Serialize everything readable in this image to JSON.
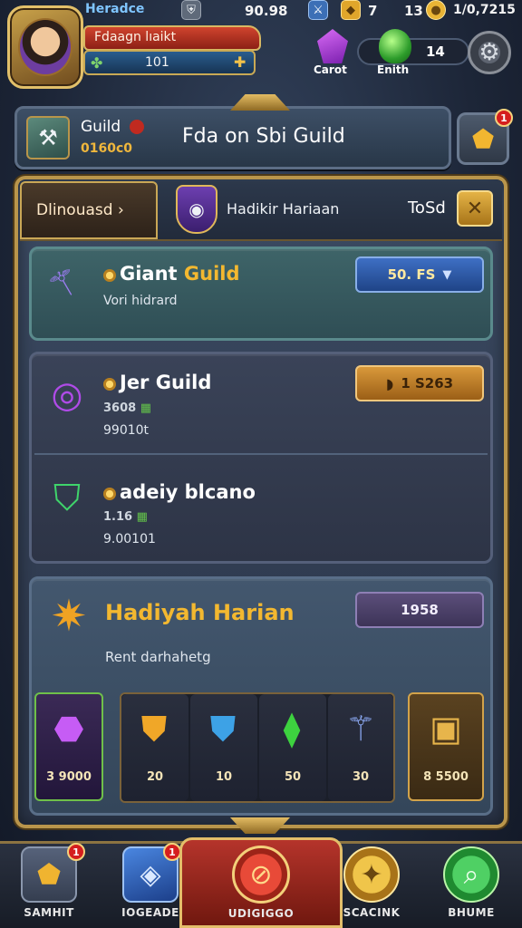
{
  "top": {
    "label": "Heradce",
    "stat_a": "90.98",
    "stat_b": "7",
    "stat_c": "13",
    "stat_d": "1/0,7215",
    "player_name": "Fdaagn lıaikt",
    "level": "101",
    "gem_labels": [
      "Carot",
      "Enith"
    ],
    "gem_count": "14"
  },
  "guild_header": {
    "label": "Guild",
    "sub": "0160c0",
    "title": "Fda on Sbi Guild",
    "badge": "1"
  },
  "tabs": {
    "active": "Dlinouasd ›",
    "middle": "Hadikir Hariaan",
    "right": "ToSd"
  },
  "guilds": [
    {
      "prefix": "Giant ",
      "accent": "Guild",
      "sub": "Vori hidrard",
      "button": "50. FS"
    },
    {
      "prefix": "Jer ",
      "accent": "",
      "name": "Guild",
      "stat": "3608",
      "sub": "99010t",
      "button": "1 S263"
    },
    {
      "prefix": "adeiy blcano",
      "accent": "",
      "stat": "1.16",
      "sub": "9.00101"
    }
  ],
  "daily": {
    "title": "Hadiyah Harian",
    "desc": "Rent darhahetg",
    "button": "1958",
    "rewards": [
      {
        "icon": "purple-gem-icon",
        "qty": "3 9000"
      },
      {
        "icon": "gold-shield-icon",
        "qty": "20"
      },
      {
        "icon": "blue-shield-icon",
        "qty": "10"
      },
      {
        "icon": "green-crystal-icon",
        "qty": "50"
      },
      {
        "icon": "staff-icon",
        "qty": "30"
      },
      {
        "icon": "treasure-chest-icon",
        "qty": "8 5500"
      }
    ]
  },
  "nav": {
    "items": [
      "SAMHIT",
      "IOGEADE",
      "UDIGIGGO",
      "SCACINK",
      "BHUME"
    ],
    "badges": [
      "1",
      "1"
    ]
  },
  "colors": {
    "gold": "#d9a441",
    "panel": "#3b4a62",
    "accent": "#f3b830"
  }
}
